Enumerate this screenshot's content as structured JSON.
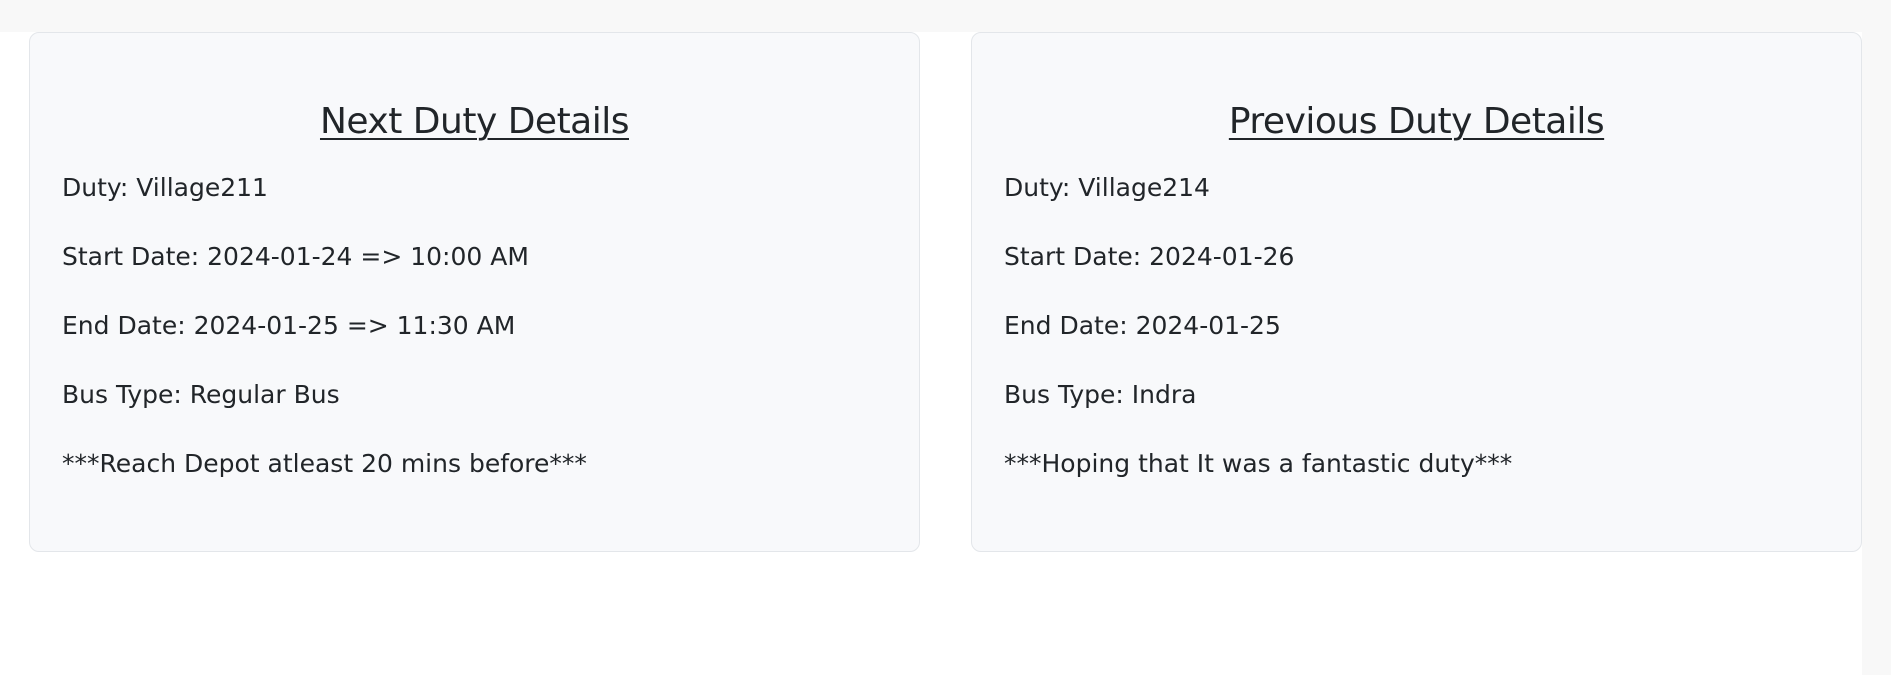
{
  "next_duty": {
    "title": "Next Duty Details",
    "duty": "Duty: Village211",
    "start_date": "Start Date: 2024-01-24 => 10:00 AM",
    "end_date": "End Date: 2024-01-25 => 11:30 AM",
    "bus_type": "Bus Type: Regular Bus",
    "note": "***Reach Depot atleast 20 mins before***"
  },
  "previous_duty": {
    "title": "Previous Duty Details",
    "duty": "Duty: Village214",
    "start_date": "Start Date: 2024-01-26",
    "end_date": "End Date: 2024-01-25",
    "bus_type": "Bus Type: Indra",
    "note": "***Hoping that It was a fantastic duty***"
  },
  "colors": {
    "page_background": "#f8f8f8",
    "content_background": "#ffffff",
    "card_background": "#f8f9fb",
    "card_border": "#e3e6ea",
    "text": "#212529"
  }
}
